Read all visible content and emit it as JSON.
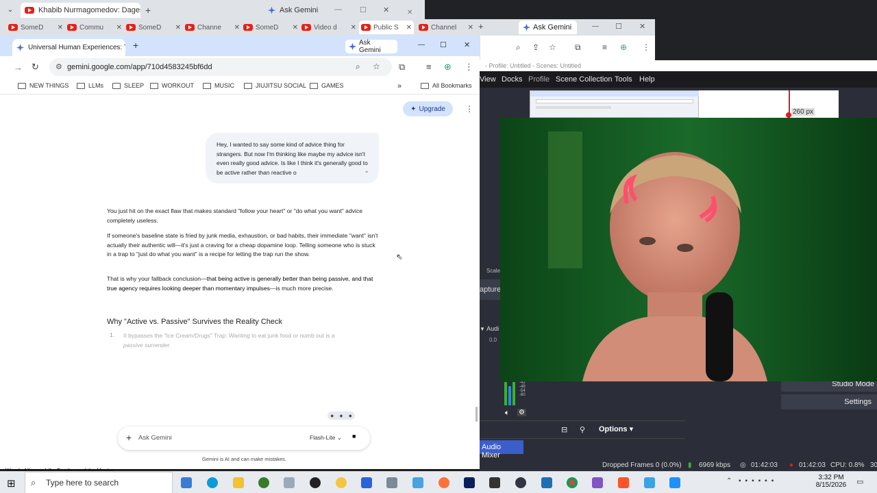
{
  "back_browser": {
    "tab1": "Khabib Nurmagomedov: Dages",
    "tab2": "Ask Gemini"
  },
  "middle_browser": {
    "tabs": [
      "SomeD",
      "Commu",
      "SomeD",
      "Channe",
      "SomeD",
      "Video d",
      "Public S",
      "Channel"
    ],
    "gemini_tab": "Ask Gemini"
  },
  "front_browser": {
    "tab_title": "Universal Human Experiences: T",
    "gemini_tab": "Ask Gemini",
    "url": "gemini.google.com/app/710d4583245bf6dd",
    "bookmarks": [
      "NEW THINGS",
      "LLMs",
      "SLEEP",
      "WORKOUT",
      "MUSIC",
      "JIUJITSU SOCIAL",
      "GAMES"
    ],
    "all_bookmarks": "All Bookmarks"
  },
  "gemini": {
    "upgrade_label": "Upgrade",
    "user_message": "Hey, I wanted to say some kind of advice thing for strangers. But now I'm thinking like maybe my advice isn't even really good advice. Is like I think it's generally good to be active rather than reactive o",
    "p1": "You just hit on the exact flaw that makes standard \"follow your heart\" or \"do what you want\" advice completely useless.",
    "p2": "If someone's baseline state is fried by junk media, exhaustion, or bad habits, their immediate \"want\" isn't actually their authentic will—it's just a craving for a cheap dopamine loop. Telling someone who is stuck in a trap to \"just do what you want\" is a recipe for letting the trap run the show.",
    "p3_a": "That is why your fallback conclusion—",
    "p3_b": "that being active is generally better than being passive, and that true agency requires looking deeper than momentary impulses",
    "p3_c": "—is much more precise.",
    "heading": "Why \"Active vs. Passive\" Survives the Reality Check",
    "li_num": "1.",
    "li_bold": "It bypasses the \"Ice Cream/Drugs\" Trap:",
    "li_text": " Wanting to eat junk food or numb out is a",
    "li_ital": "passive surrender",
    "input_placeholder": "Ask Gemini",
    "model_label": "Flash-Lite",
    "disclaimer": "Gemini is AI and can make mistakes."
  },
  "obs": {
    "title": "- Profile: Untitled - Scenes: Untitled",
    "menu": [
      "View",
      "Docks",
      "Profile",
      "Scene Collection",
      "Tools",
      "Help"
    ],
    "px_label": "260 px",
    "scale_label": "Scale",
    "capture_label": "apture",
    "audio_label": "Audi",
    "audio_value": "0.0",
    "meter_ticks": [
      "-42",
      "-48",
      "-54",
      "-60"
    ],
    "options_label": "Options",
    "audio_mixer_label": "Audio Mixer",
    "studio_mode": "Studio Mode",
    "settings": "Settings",
    "dropped_frames": "Dropped Frames 0 (0.0%)",
    "bitrate": "6969 kbps",
    "stream_time": "01:42:03",
    "rec_time": "01:42:03",
    "cpu": "CPU: 0.8%",
    "fps_stub": "30"
  },
  "video_title": "Woody Allen on Life, Death—and the Movies",
  "taskbar": {
    "search_placeholder": "Type here to search",
    "time": "3:32 PM",
    "date": "8/15/2026"
  },
  "colors": {
    "gemini_blue": "#d3e3fd",
    "obs_dark": "#2b2e38",
    "rec_red": "#e11b22",
    "green_screen": "#10381a"
  }
}
